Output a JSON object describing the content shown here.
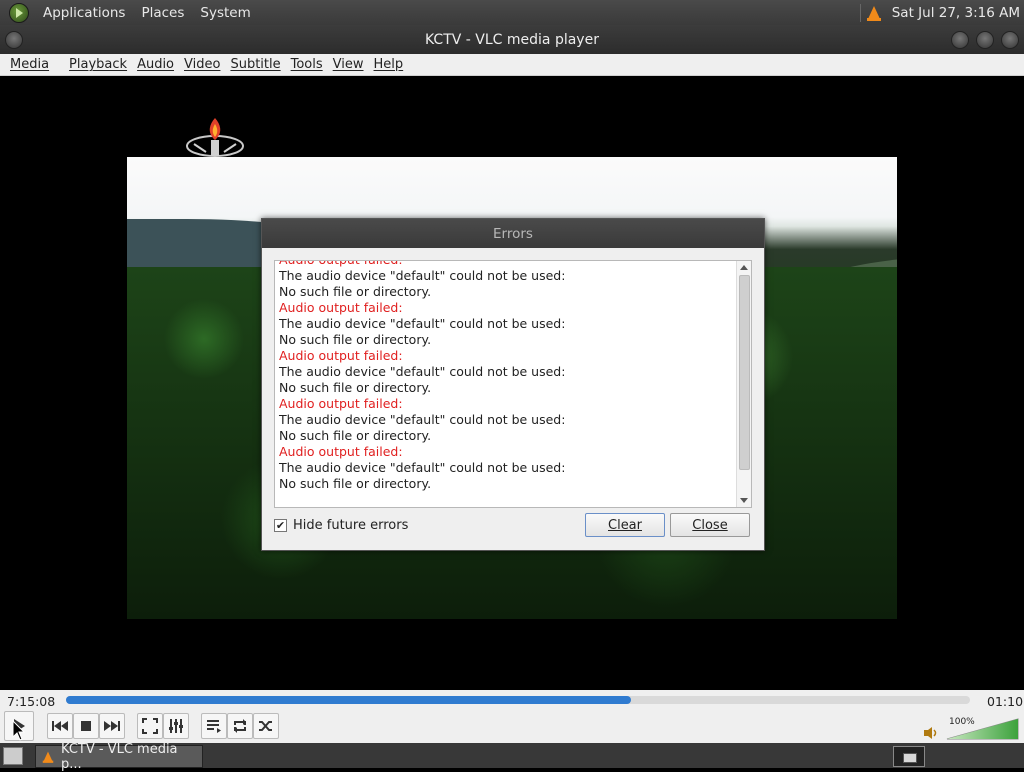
{
  "top_panel": {
    "menus": [
      "Applications",
      "Places",
      "System"
    ],
    "clock": "Sat Jul 27,  3:16 AM",
    "tray_icon": "vlc-cone-icon"
  },
  "window": {
    "title": "KCTV - VLC media player"
  },
  "menubar": {
    "items": [
      "Media",
      "Playback",
      "Audio",
      "Video",
      "Subtitle",
      "Tools",
      "View",
      "Help"
    ]
  },
  "errors_dialog": {
    "title": "Errors",
    "log": [
      {
        "text": "Audio output failed:",
        "type": "error"
      },
      {
        "text": "The audio device \"default\" could not be used:",
        "type": "info"
      },
      {
        "text": "No such file or directory.",
        "type": "info"
      },
      {
        "text": "Audio output failed:",
        "type": "error"
      },
      {
        "text": "The audio device \"default\" could not be used:",
        "type": "info"
      },
      {
        "text": "No such file or directory.",
        "type": "info"
      },
      {
        "text": "Audio output failed:",
        "type": "error"
      },
      {
        "text": "The audio device \"default\" could not be used:",
        "type": "info"
      },
      {
        "text": "No such file or directory.",
        "type": "info"
      },
      {
        "text": "Audio output failed:",
        "type": "error"
      },
      {
        "text": "The audio device \"default\" could not be used:",
        "type": "info"
      },
      {
        "text": "No such file or directory.",
        "type": "info"
      },
      {
        "text": "Audio output failed:",
        "type": "error"
      },
      {
        "text": "The audio device \"default\" could not be used:",
        "type": "info"
      },
      {
        "text": "No such file or directory.",
        "type": "info"
      }
    ],
    "hide_future_errors_label": "Hide future errors",
    "hide_future_errors_checked": true,
    "clear_label": "Clear",
    "close_label": "Close",
    "error_color": "#e02020"
  },
  "controls": {
    "elapsed": "7:15:08",
    "remaining": "01:10",
    "seek_progress": 0.625,
    "volume_percent": "100%",
    "volume_level": 1.0,
    "accent_color": "#2f7bd0"
  },
  "taskbar": {
    "task_label": "KCTV - VLC media p..."
  }
}
